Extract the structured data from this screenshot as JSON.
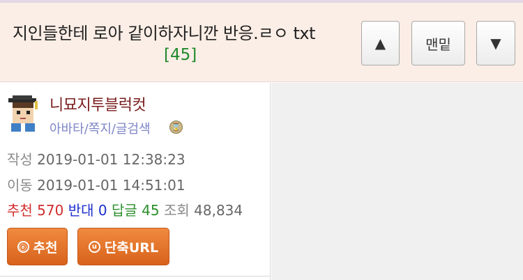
{
  "header": {
    "title": "지인들한테 로아 같이하자니깐 반응.ㄹㅇ txt",
    "reply_count": "[45]",
    "up_label": "▲",
    "bottom_label": "맨밑",
    "down_label": "▼"
  },
  "author": {
    "name": "니묘지투블럭컷",
    "link_avatar": "아바타",
    "link_note": "쪽지",
    "link_search": "글검색",
    "sep": "/",
    "badge_icon": "hourglass-icon"
  },
  "meta": {
    "written_label": "작성",
    "written_value": "2019-01-01 12:38:23",
    "moved_label": "이동",
    "moved_value": "2019-01-01 14:51:01"
  },
  "stats": {
    "recommend_label": "추천",
    "recommend_value": "570",
    "oppose_label": "반대",
    "oppose_value": "0",
    "reply_label": "답글",
    "reply_value": "45",
    "views_label": "조회",
    "views_value": "48,834"
  },
  "actions": {
    "recommend_label": "추천",
    "recommend_glyph": "ⓞ",
    "shorturl_label": "단축URL",
    "shorturl_glyph": "u"
  },
  "colors": {
    "header_bg": "#fbeee6",
    "reply_count": "#1f8a2c",
    "author": "#7a1e1e",
    "links": "#7e86c7",
    "orange_button": "#e3722b"
  }
}
